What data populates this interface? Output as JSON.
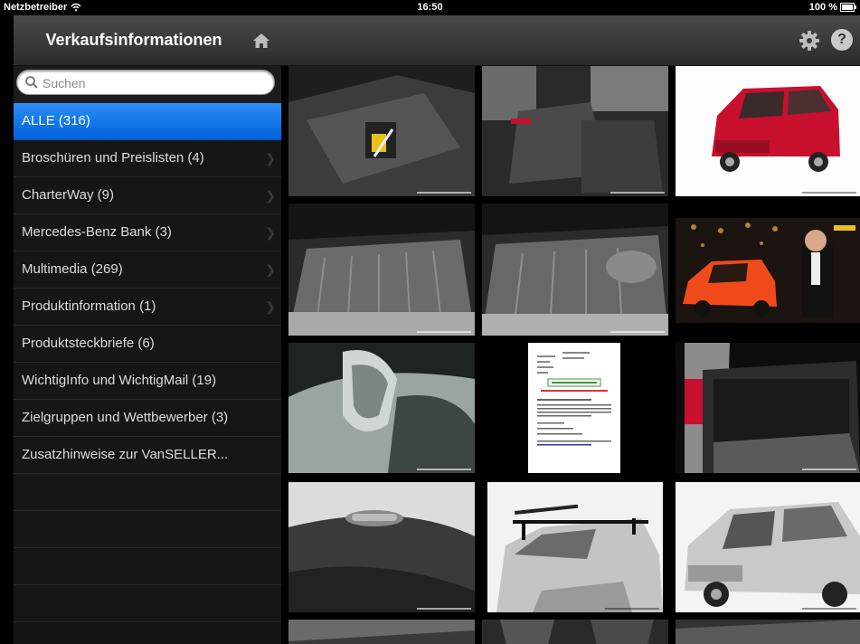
{
  "status": {
    "carrier": "Netzbetreiber",
    "time": "16:50",
    "battery": "100 %"
  },
  "sidebar": {
    "title": "Verkaufsinformationen",
    "search_placeholder": "Suchen",
    "items": [
      {
        "label": "ALLE (316)",
        "active": true
      },
      {
        "label": "Broschüren und Preislisten (4)"
      },
      {
        "label": "CharterWay (9)"
      },
      {
        "label": "Mercedes-Benz Bank (3)"
      },
      {
        "label": "Multimedia (269)"
      },
      {
        "label": "Produktinformation (1)"
      },
      {
        "label": "Produktsteckbriefe (6)"
      },
      {
        "label": "WichtigInfo und WichtigMail (19)"
      },
      {
        "label": "Zielgruppen und Wettbewerber (3)"
      },
      {
        "label": "Zusatzhinweise zur VanSELLER..."
      }
    ]
  },
  "toolbar": {
    "help_label": "?"
  },
  "colors": {
    "accent": "#0a6fe6",
    "header": "#3a3a3a",
    "van_red": "#c8102e",
    "van_orange": "#f04a1a"
  }
}
